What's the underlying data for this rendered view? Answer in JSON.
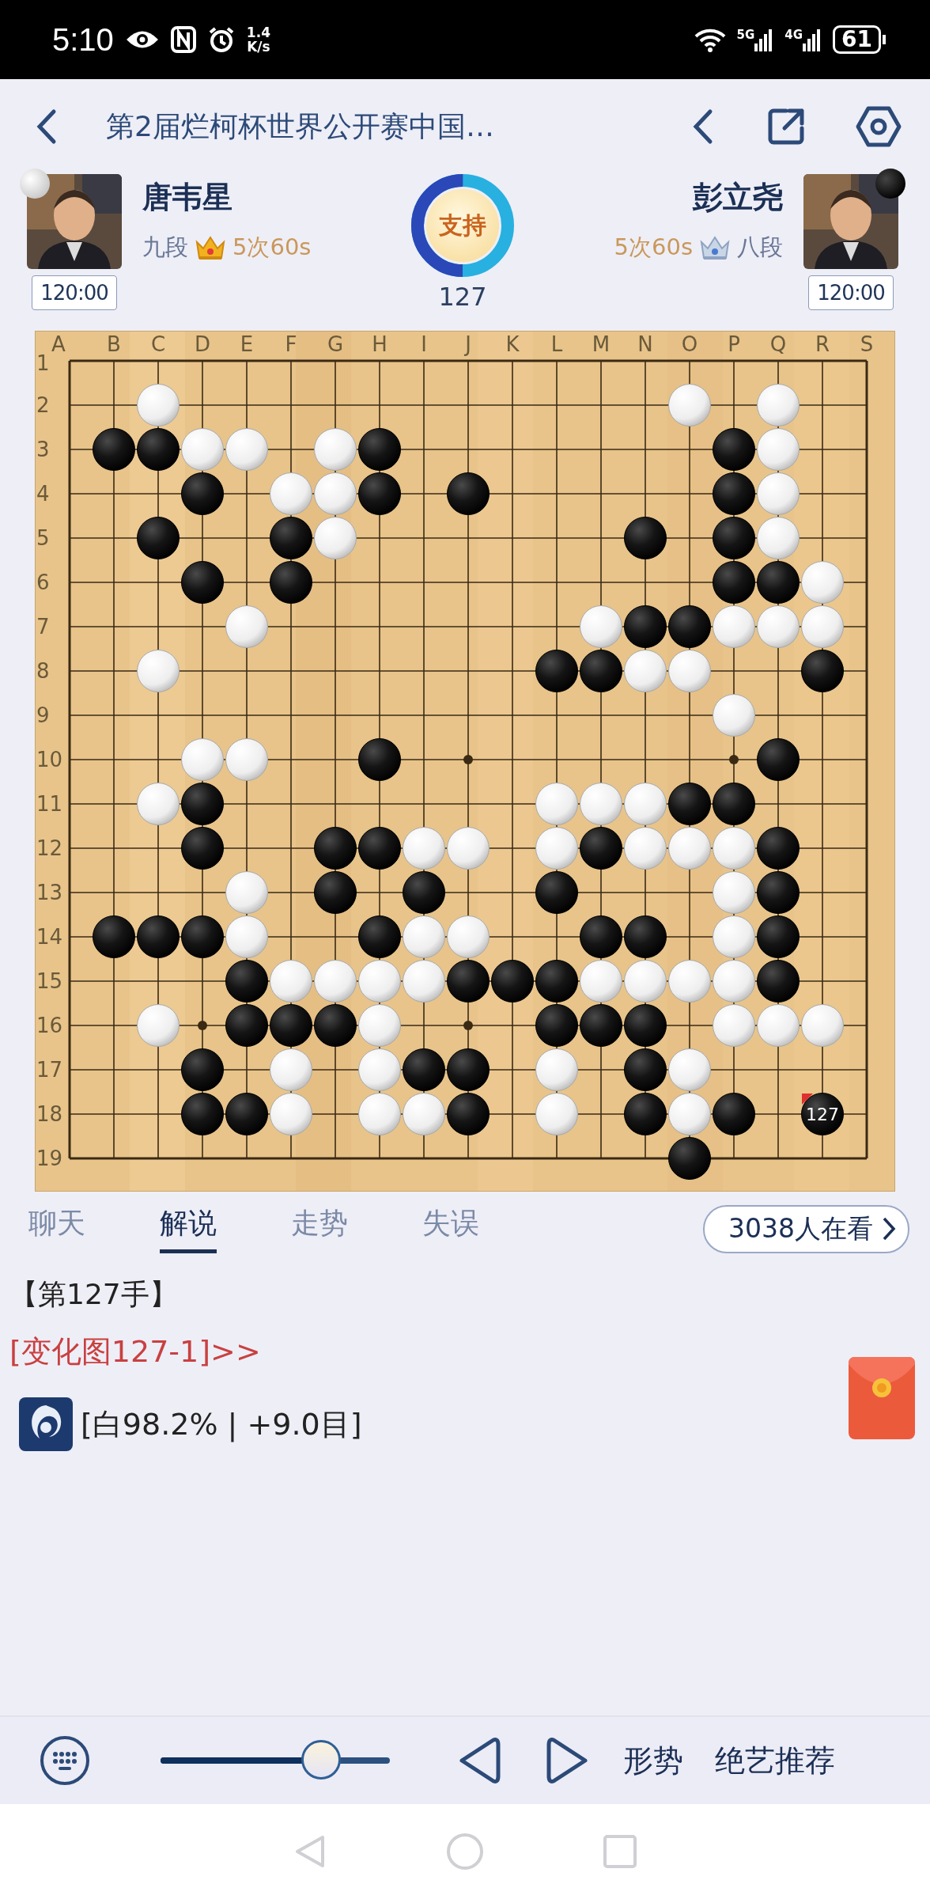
{
  "status_bar": {
    "time": "5:10",
    "net_speed": [
      "1.4",
      "K/s"
    ],
    "network_labels": [
      "5G",
      "4G"
    ],
    "battery": "61"
  },
  "header": {
    "title": "第2届烂柯杯世界公开赛中国…"
  },
  "players": [
    {
      "kind": "white",
      "name": "唐韦星",
      "rank": "九段",
      "byoyomi": "5次60s",
      "clock": "120:00"
    },
    {
      "kind": "black",
      "name": "彭立尧",
      "rank": "八段",
      "byoyomi": "5次60s",
      "clock": "120:00"
    }
  ],
  "support": {
    "label": "支持",
    "level": 0.5,
    "move_number": "127"
  },
  "board": {
    "columns": [
      "A",
      "B",
      "C",
      "D",
      "E",
      "F",
      "G",
      "H",
      "I",
      "J",
      "K",
      "L",
      "M",
      "N",
      "O",
      "P",
      "Q",
      "R",
      "S"
    ],
    "rows": [
      "1",
      "2",
      "3",
      "4",
      "5",
      "6",
      "7",
      "8",
      "9",
      "10",
      "11",
      "12",
      "13",
      "14",
      "15",
      "16",
      "17",
      "18",
      "19"
    ],
    "grid": [
      [
        {
          "kind": "none"
        },
        {
          "kind": "none"
        },
        {
          "kind": "none"
        },
        {
          "kind": "none"
        },
        {
          "kind": "none"
        },
        {
          "kind": "none"
        },
        {
          "kind": "none"
        },
        {
          "kind": "none"
        },
        {
          "kind": "none"
        },
        {
          "kind": "none"
        },
        {
          "kind": "none"
        },
        {
          "kind": "none"
        },
        {
          "kind": "none"
        },
        {
          "kind": "none"
        },
        {
          "kind": "none"
        },
        {
          "kind": "none"
        },
        {
          "kind": "none"
        },
        {
          "kind": "none"
        },
        {
          "kind": "none"
        }
      ],
      [
        {
          "kind": "none"
        },
        {
          "kind": "none"
        },
        {
          "kind": "white"
        },
        {
          "kind": "none"
        },
        {
          "kind": "none"
        },
        {
          "kind": "none"
        },
        {
          "kind": "none"
        },
        {
          "kind": "none"
        },
        {
          "kind": "none"
        },
        {
          "kind": "none"
        },
        {
          "kind": "none"
        },
        {
          "kind": "none"
        },
        {
          "kind": "none"
        },
        {
          "kind": "none"
        },
        {
          "kind": "white"
        },
        {
          "kind": "none"
        },
        {
          "kind": "white"
        },
        {
          "kind": "none"
        },
        {
          "kind": "none"
        }
      ],
      [
        {
          "kind": "none"
        },
        {
          "kind": "black"
        },
        {
          "kind": "black"
        },
        {
          "kind": "white"
        },
        {
          "kind": "white"
        },
        {
          "kind": "none"
        },
        {
          "kind": "white"
        },
        {
          "kind": "black"
        },
        {
          "kind": "none"
        },
        {
          "kind": "none"
        },
        {
          "kind": "none"
        },
        {
          "kind": "none"
        },
        {
          "kind": "none"
        },
        {
          "kind": "none"
        },
        {
          "kind": "none"
        },
        {
          "kind": "black"
        },
        {
          "kind": "white"
        },
        {
          "kind": "none"
        },
        {
          "kind": "none"
        }
      ],
      [
        {
          "kind": "none"
        },
        {
          "kind": "none"
        },
        {
          "kind": "none"
        },
        {
          "kind": "black"
        },
        {
          "kind": "none"
        },
        {
          "kind": "white"
        },
        {
          "kind": "white"
        },
        {
          "kind": "black"
        },
        {
          "kind": "none"
        },
        {
          "kind": "black"
        },
        {
          "kind": "none"
        },
        {
          "kind": "none"
        },
        {
          "kind": "none"
        },
        {
          "kind": "none"
        },
        {
          "kind": "none"
        },
        {
          "kind": "black"
        },
        {
          "kind": "white"
        },
        {
          "kind": "none"
        },
        {
          "kind": "none"
        }
      ],
      [
        {
          "kind": "none"
        },
        {
          "kind": "none"
        },
        {
          "kind": "black"
        },
        {
          "kind": "none"
        },
        {
          "kind": "none"
        },
        {
          "kind": "black"
        },
        {
          "kind": "white"
        },
        {
          "kind": "none"
        },
        {
          "kind": "none"
        },
        {
          "kind": "none"
        },
        {
          "kind": "none"
        },
        {
          "kind": "none"
        },
        {
          "kind": "none"
        },
        {
          "kind": "black"
        },
        {
          "kind": "none"
        },
        {
          "kind": "black"
        },
        {
          "kind": "white"
        },
        {
          "kind": "none"
        },
        {
          "kind": "none"
        }
      ],
      [
        {
          "kind": "none"
        },
        {
          "kind": "none"
        },
        {
          "kind": "none"
        },
        {
          "kind": "black"
        },
        {
          "kind": "none"
        },
        {
          "kind": "black"
        },
        {
          "kind": "none"
        },
        {
          "kind": "none"
        },
        {
          "kind": "none"
        },
        {
          "kind": "none"
        },
        {
          "kind": "none"
        },
        {
          "kind": "none"
        },
        {
          "kind": "none"
        },
        {
          "kind": "none"
        },
        {
          "kind": "none"
        },
        {
          "kind": "black"
        },
        {
          "kind": "black"
        },
        {
          "kind": "white"
        },
        {
          "kind": "none"
        }
      ],
      [
        {
          "kind": "none"
        },
        {
          "kind": "none"
        },
        {
          "kind": "none"
        },
        {
          "kind": "none"
        },
        {
          "kind": "white"
        },
        {
          "kind": "none"
        },
        {
          "kind": "none"
        },
        {
          "kind": "none"
        },
        {
          "kind": "none"
        },
        {
          "kind": "none"
        },
        {
          "kind": "none"
        },
        {
          "kind": "none"
        },
        {
          "kind": "white"
        },
        {
          "kind": "black"
        },
        {
          "kind": "black"
        },
        {
          "kind": "white"
        },
        {
          "kind": "white"
        },
        {
          "kind": "white"
        },
        {
          "kind": "none"
        }
      ],
      [
        {
          "kind": "none"
        },
        {
          "kind": "none"
        },
        {
          "kind": "white"
        },
        {
          "kind": "none"
        },
        {
          "kind": "none"
        },
        {
          "kind": "none"
        },
        {
          "kind": "none"
        },
        {
          "kind": "none"
        },
        {
          "kind": "none"
        },
        {
          "kind": "none"
        },
        {
          "kind": "none"
        },
        {
          "kind": "black"
        },
        {
          "kind": "black"
        },
        {
          "kind": "white"
        },
        {
          "kind": "white"
        },
        {
          "kind": "none"
        },
        {
          "kind": "none"
        },
        {
          "kind": "black"
        },
        {
          "kind": "none"
        }
      ],
      [
        {
          "kind": "none"
        },
        {
          "kind": "none"
        },
        {
          "kind": "none"
        },
        {
          "kind": "none"
        },
        {
          "kind": "none"
        },
        {
          "kind": "none"
        },
        {
          "kind": "none"
        },
        {
          "kind": "none"
        },
        {
          "kind": "none"
        },
        {
          "kind": "none"
        },
        {
          "kind": "none"
        },
        {
          "kind": "none"
        },
        {
          "kind": "none"
        },
        {
          "kind": "none"
        },
        {
          "kind": "none"
        },
        {
          "kind": "white"
        },
        {
          "kind": "none"
        },
        {
          "kind": "none"
        },
        {
          "kind": "none"
        }
      ],
      [
        {
          "kind": "none"
        },
        {
          "kind": "none"
        },
        {
          "kind": "none"
        },
        {
          "kind": "white"
        },
        {
          "kind": "white"
        },
        {
          "kind": "none"
        },
        {
          "kind": "none"
        },
        {
          "kind": "black"
        },
        {
          "kind": "none"
        },
        {
          "kind": "none"
        },
        {
          "kind": "none"
        },
        {
          "kind": "none"
        },
        {
          "kind": "none"
        },
        {
          "kind": "none"
        },
        {
          "kind": "none"
        },
        {
          "kind": "none"
        },
        {
          "kind": "black"
        },
        {
          "kind": "none"
        },
        {
          "kind": "none"
        }
      ],
      [
        {
          "kind": "none"
        },
        {
          "kind": "none"
        },
        {
          "kind": "white"
        },
        {
          "kind": "black"
        },
        {
          "kind": "none"
        },
        {
          "kind": "none"
        },
        {
          "kind": "none"
        },
        {
          "kind": "none"
        },
        {
          "kind": "none"
        },
        {
          "kind": "none"
        },
        {
          "kind": "none"
        },
        {
          "kind": "white"
        },
        {
          "kind": "white"
        },
        {
          "kind": "white"
        },
        {
          "kind": "black"
        },
        {
          "kind": "black"
        },
        {
          "kind": "none"
        },
        {
          "kind": "none"
        },
        {
          "kind": "none"
        }
      ],
      [
        {
          "kind": "none"
        },
        {
          "kind": "none"
        },
        {
          "kind": "none"
        },
        {
          "kind": "black"
        },
        {
          "kind": "none"
        },
        {
          "kind": "none"
        },
        {
          "kind": "black"
        },
        {
          "kind": "black"
        },
        {
          "kind": "white"
        },
        {
          "kind": "white"
        },
        {
          "kind": "none"
        },
        {
          "kind": "white"
        },
        {
          "kind": "black"
        },
        {
          "kind": "white"
        },
        {
          "kind": "white"
        },
        {
          "kind": "white"
        },
        {
          "kind": "black"
        },
        {
          "kind": "none"
        },
        {
          "kind": "none"
        }
      ],
      [
        {
          "kind": "none"
        },
        {
          "kind": "none"
        },
        {
          "kind": "none"
        },
        {
          "kind": "none"
        },
        {
          "kind": "white"
        },
        {
          "kind": "none"
        },
        {
          "kind": "black"
        },
        {
          "kind": "none"
        },
        {
          "kind": "black"
        },
        {
          "kind": "none"
        },
        {
          "kind": "none"
        },
        {
          "kind": "black"
        },
        {
          "kind": "none"
        },
        {
          "kind": "none"
        },
        {
          "kind": "none"
        },
        {
          "kind": "white"
        },
        {
          "kind": "black"
        },
        {
          "kind": "none"
        },
        {
          "kind": "none"
        }
      ],
      [
        {
          "kind": "none"
        },
        {
          "kind": "black"
        },
        {
          "kind": "black"
        },
        {
          "kind": "black"
        },
        {
          "kind": "white"
        },
        {
          "kind": "none"
        },
        {
          "kind": "none"
        },
        {
          "kind": "black"
        },
        {
          "kind": "white"
        },
        {
          "kind": "white"
        },
        {
          "kind": "none"
        },
        {
          "kind": "none"
        },
        {
          "kind": "black"
        },
        {
          "kind": "black"
        },
        {
          "kind": "none"
        },
        {
          "kind": "white"
        },
        {
          "kind": "black"
        },
        {
          "kind": "none"
        },
        {
          "kind": "none"
        }
      ],
      [
        {
          "kind": "none"
        },
        {
          "kind": "none"
        },
        {
          "kind": "none"
        },
        {
          "kind": "none"
        },
        {
          "kind": "black"
        },
        {
          "kind": "white"
        },
        {
          "kind": "white"
        },
        {
          "kind": "white"
        },
        {
          "kind": "white"
        },
        {
          "kind": "black"
        },
        {
          "kind": "black"
        },
        {
          "kind": "black"
        },
        {
          "kind": "white"
        },
        {
          "kind": "white"
        },
        {
          "kind": "white"
        },
        {
          "kind": "white"
        },
        {
          "kind": "black"
        },
        {
          "kind": "none"
        },
        {
          "kind": "none"
        }
      ],
      [
        {
          "kind": "none"
        },
        {
          "kind": "none"
        },
        {
          "kind": "white"
        },
        {
          "kind": "none"
        },
        {
          "kind": "black"
        },
        {
          "kind": "black"
        },
        {
          "kind": "black"
        },
        {
          "kind": "white"
        },
        {
          "kind": "none"
        },
        {
          "kind": "none"
        },
        {
          "kind": "none"
        },
        {
          "kind": "black"
        },
        {
          "kind": "black"
        },
        {
          "kind": "black"
        },
        {
          "kind": "none"
        },
        {
          "kind": "white"
        },
        {
          "kind": "white"
        },
        {
          "kind": "white"
        },
        {
          "kind": "none"
        }
      ],
      [
        {
          "kind": "none"
        },
        {
          "kind": "none"
        },
        {
          "kind": "none"
        },
        {
          "kind": "black"
        },
        {
          "kind": "none"
        },
        {
          "kind": "white"
        },
        {
          "kind": "none"
        },
        {
          "kind": "white"
        },
        {
          "kind": "black"
        },
        {
          "kind": "black"
        },
        {
          "kind": "none"
        },
        {
          "kind": "white"
        },
        {
          "kind": "none"
        },
        {
          "kind": "black"
        },
        {
          "kind": "white"
        },
        {
          "kind": "none"
        },
        {
          "kind": "none"
        },
        {
          "kind": "none"
        },
        {
          "kind": "none"
        }
      ],
      [
        {
          "kind": "none"
        },
        {
          "kind": "none"
        },
        {
          "kind": "none"
        },
        {
          "kind": "black"
        },
        {
          "kind": "black"
        },
        {
          "kind": "white"
        },
        {
          "kind": "none"
        },
        {
          "kind": "white"
        },
        {
          "kind": "white"
        },
        {
          "kind": "black"
        },
        {
          "kind": "none"
        },
        {
          "kind": "white"
        },
        {
          "kind": "none"
        },
        {
          "kind": "black"
        },
        {
          "kind": "white"
        },
        {
          "kind": "black"
        },
        {
          "kind": "none"
        },
        {
          "kind": "black",
          "last_move": true
        },
        {
          "kind": "none"
        }
      ],
      [
        {
          "kind": "none"
        },
        {
          "kind": "none"
        },
        {
          "kind": "none"
        },
        {
          "kind": "none"
        },
        {
          "kind": "none"
        },
        {
          "kind": "none"
        },
        {
          "kind": "none"
        },
        {
          "kind": "none"
        },
        {
          "kind": "none"
        },
        {
          "kind": "none"
        },
        {
          "kind": "none"
        },
        {
          "kind": "none"
        },
        {
          "kind": "none"
        },
        {
          "kind": "none"
        },
        {
          "kind": "black"
        },
        {
          "kind": "none"
        },
        {
          "kind": "none"
        },
        {
          "kind": "none"
        },
        {
          "kind": "none"
        }
      ]
    ],
    "last_move_label": "127"
  },
  "tabs": [
    {
      "label": "聊天",
      "selected": false
    },
    {
      "label": "解说",
      "selected": true
    },
    {
      "label": "走势",
      "selected": false
    },
    {
      "label": "失误",
      "selected": false
    }
  ],
  "viewers": "3038人在看",
  "commentary": {
    "move_title": "【第127手】",
    "variation_link": "[变化图127-1]>>",
    "ai_result": "[白98.2% | +9.0目]"
  },
  "toolbar": {
    "slider": {
      "level": 0.7
    },
    "buttons": [
      "形势",
      "绝艺推荐"
    ]
  }
}
